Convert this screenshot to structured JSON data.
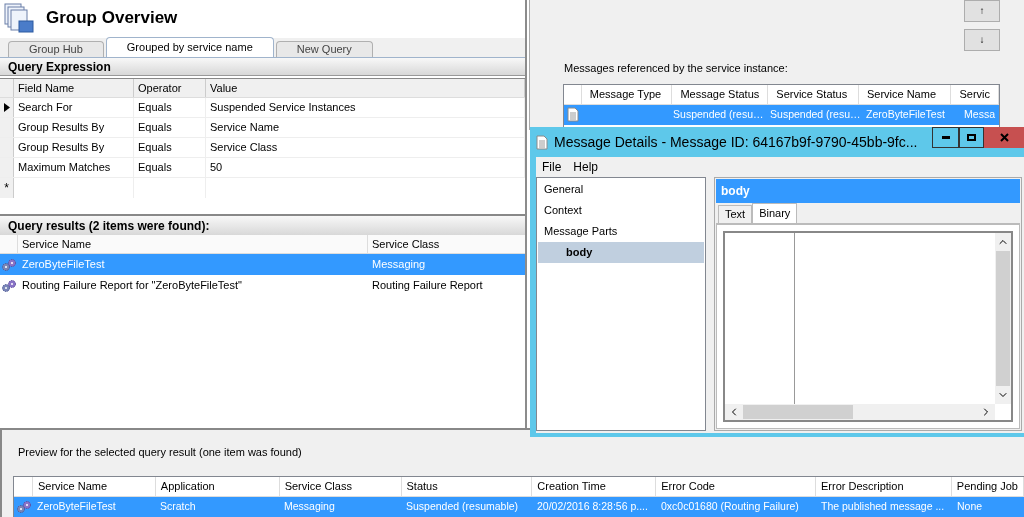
{
  "main": {
    "title": "Group Overview",
    "tabs": [
      {
        "label": "Group Hub",
        "selected": false
      },
      {
        "label": "Grouped by service name",
        "selected": true
      },
      {
        "label": "New Query",
        "selected": false
      }
    ],
    "query_expression": {
      "title": "Query Expression",
      "columns": [
        "Field Name",
        "Operator",
        "Value"
      ],
      "rows": [
        {
          "cells": [
            "Search For",
            "Equals",
            "Suspended Service Instances"
          ],
          "current": true
        },
        {
          "cells": [
            "Group Results By",
            "Equals",
            "Service Name"
          ],
          "current": false
        },
        {
          "cells": [
            "Group Results By",
            "Equals",
            "Service Class"
          ],
          "current": false
        },
        {
          "cells": [
            "Maximum Matches",
            "Equals",
            "50"
          ],
          "current": false
        }
      ],
      "new_row_marker": "*"
    },
    "query_results": {
      "title": "Query results (2 items were found):",
      "columns": [
        "Service Name",
        "Service Class"
      ],
      "rows": [
        {
          "cells": [
            "ZeroByteFileTest",
            "Messaging"
          ],
          "selected": true
        },
        {
          "cells": [
            "Routing Failure Report for \"ZeroByteFileTest\"",
            "Routing Failure Report"
          ],
          "selected": false
        }
      ]
    }
  },
  "messages_dialog": {
    "buttons": [
      "↑",
      "↓"
    ],
    "label": "Messages referenced by the service instance:",
    "columns": [
      "Message Type",
      "Message Status",
      "Service Status",
      "Service Name",
      "Servic"
    ],
    "rows": [
      {
        "cells": [
          "",
          "Suspended (resu…",
          "Suspended (resu…",
          "ZeroByteFileTest",
          "Messa"
        ],
        "selected": true
      }
    ]
  },
  "message_details": {
    "title": "Message Details - Message ID: 64167b9f-9790-45bb-9fc...",
    "menu": [
      "File",
      "Help"
    ],
    "tree": [
      {
        "label": "General",
        "selected": false
      },
      {
        "label": "Context",
        "selected": false
      },
      {
        "label": "Message Parts",
        "selected": false,
        "children": [
          {
            "label": "body",
            "selected": true
          }
        ]
      }
    ],
    "part_header": "body",
    "tabs": [
      {
        "label": "Text",
        "selected": false
      },
      {
        "label": "Binary",
        "selected": true
      }
    ]
  },
  "preview": {
    "title": "Preview for the selected query result (one item was found)",
    "columns": [
      "Service Name",
      "Application",
      "Service Class",
      "Status",
      "Creation Time",
      "Error Code",
      "Error Description",
      "Pending Job"
    ],
    "rows": [
      {
        "cells": [
          "ZeroByteFileTest",
          "Scratch",
          "Messaging",
          "Suspended (resumable)",
          "20/02/2016 8:28:56 p....",
          "0xc0c01680 (Routing Failure)",
          "The published message ...",
          "None"
        ],
        "selected": true
      }
    ]
  }
}
